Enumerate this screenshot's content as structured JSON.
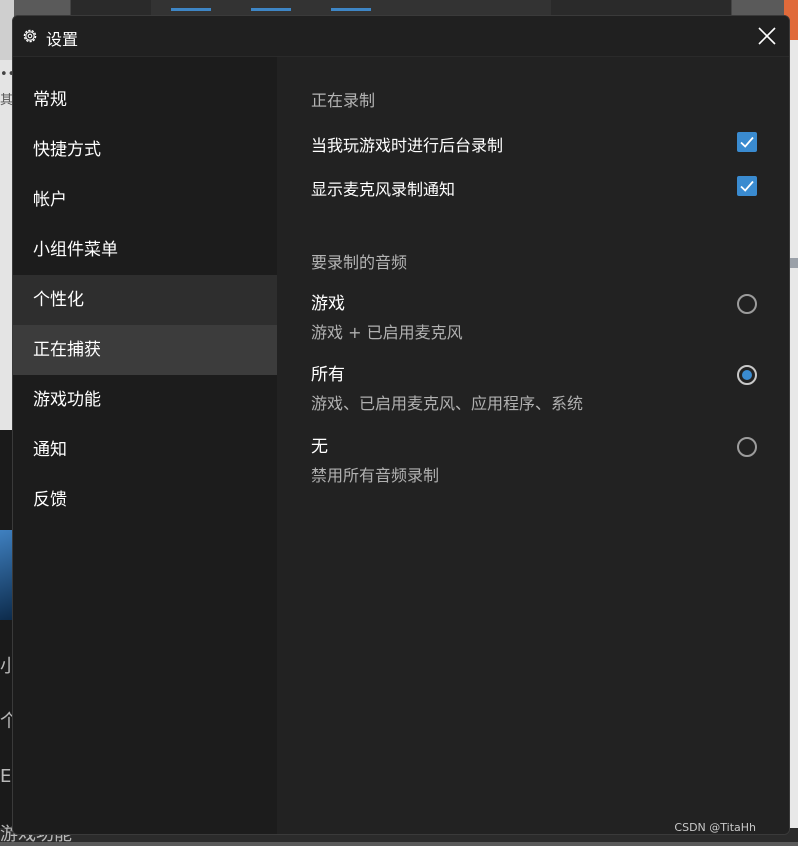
{
  "window": {
    "title": "设置",
    "title_icon": "gear-icon",
    "close_icon": "close-icon"
  },
  "sidebar": {
    "items": [
      {
        "label": "常规"
      },
      {
        "label": "快捷方式"
      },
      {
        "label": "帐户"
      },
      {
        "label": "小组件菜单"
      },
      {
        "label": "个性化"
      },
      {
        "label": "正在捕获"
      },
      {
        "label": "游戏功能"
      },
      {
        "label": "通知"
      },
      {
        "label": "反馈"
      }
    ],
    "selected": "正在捕获"
  },
  "recording": {
    "heading": "正在录制",
    "options": [
      {
        "label": "当我玩游戏时进行后台录制",
        "checked": true
      },
      {
        "label": "显示麦克风录制通知",
        "checked": true
      }
    ]
  },
  "audio": {
    "heading": "要录制的音频",
    "options": [
      {
        "title": "游戏",
        "desc": "游戏 + 已启用麦克风",
        "selected": false
      },
      {
        "title": "所有",
        "desc": "游戏、已启用麦克风、应用程序、系统",
        "selected": true
      },
      {
        "title": "无",
        "desc": "禁用所有音频录制",
        "selected": false
      }
    ]
  },
  "watermark": "CSDN @TitaHh",
  "background_text": [
    "•••",
    "其",
    "小",
    "个",
    "E",
    "游戏功能"
  ],
  "colors": {
    "accent": "#3a8bd0",
    "window_bg": "#222222",
    "sidebar_bg": "#1c1c1c",
    "selected_item_bg": "#3c3c3c"
  }
}
